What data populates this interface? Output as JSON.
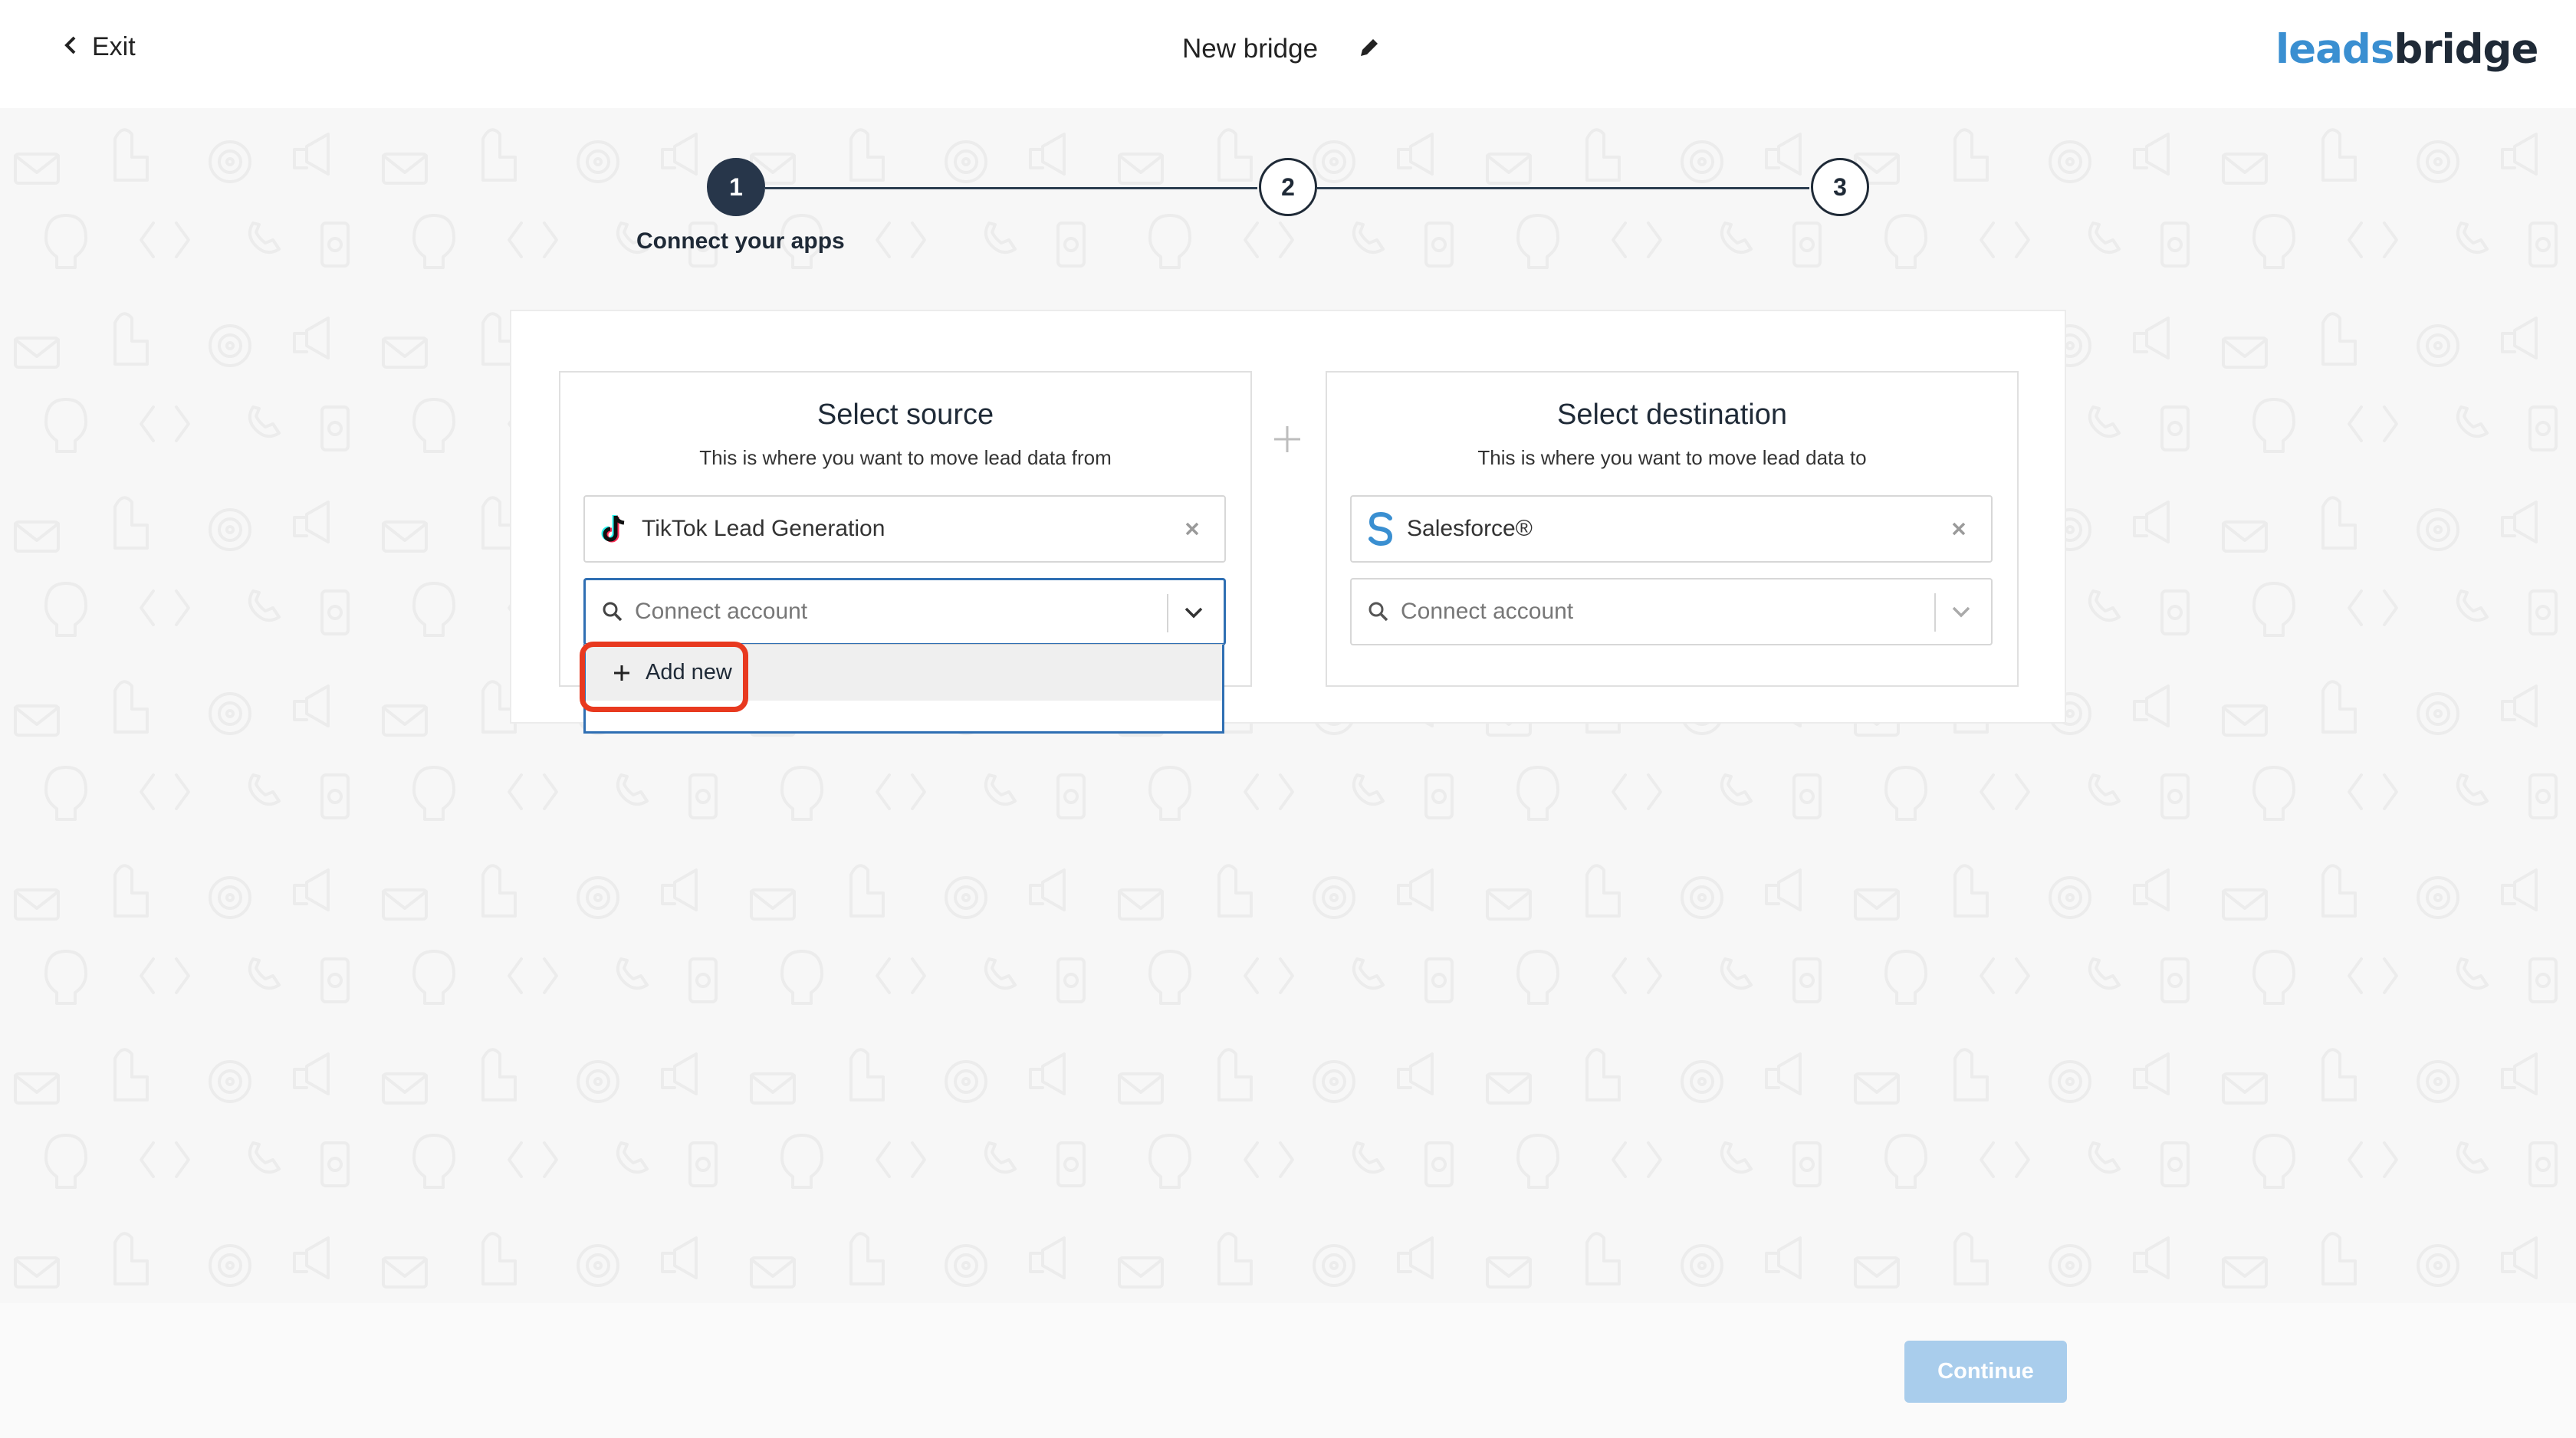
{
  "header": {
    "exit_label": "Exit",
    "title": "New bridge",
    "logo_part1": "leads",
    "logo_part2": "bridge"
  },
  "stepper": {
    "steps": [
      {
        "number": "1",
        "label": "Connect your apps",
        "active": true
      },
      {
        "number": "2",
        "label": "",
        "active": false
      },
      {
        "number": "3",
        "label": "",
        "active": false
      }
    ]
  },
  "source": {
    "title": "Select source",
    "subtitle": "This is where you want to move lead data from",
    "app_name": "TikTok Lead Generation",
    "app_icon": "tiktok-icon",
    "account_placeholder": "Connect account"
  },
  "destination": {
    "title": "Select destination",
    "subtitle": "This is where you want to move lead data to",
    "app_name": "Salesforce®",
    "app_icon": "salesforce-icon",
    "account_placeholder": "Connect account"
  },
  "dropdown": {
    "items": [
      {
        "label": "Add new",
        "icon": "plus-icon"
      }
    ]
  },
  "footer": {
    "continue_label": "Continue"
  },
  "colors": {
    "accent": "#2f6fb3",
    "highlight": "#e8391f",
    "continue_disabled": "#a9cdec",
    "step_active": "#27364a",
    "logo_blue": "#3a8fd1"
  }
}
